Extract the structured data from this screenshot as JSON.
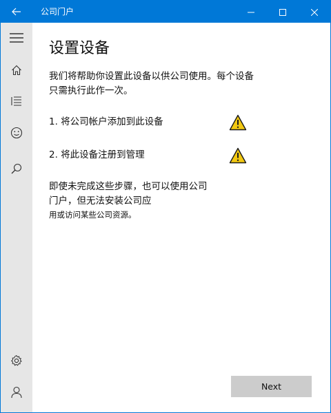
{
  "window": {
    "title": "公司门户",
    "accent_color": "#0078d7",
    "rail_color": "#e6e6e6"
  },
  "titlebar": {
    "back_icon": "back-arrow-icon",
    "minimize_icon": "minimize-icon",
    "maximize_icon": "maximize-icon",
    "close_icon": "close-icon"
  },
  "rail": {
    "items": [
      {
        "icon": "hamburger-menu-icon"
      },
      {
        "icon": "home-icon"
      },
      {
        "icon": "list-icon"
      },
      {
        "icon": "smiley-icon"
      },
      {
        "icon": "search-icon"
      }
    ],
    "bottom_items": [
      {
        "icon": "settings-gear-icon"
      },
      {
        "icon": "account-person-icon"
      }
    ]
  },
  "main": {
    "heading": "设置设备",
    "intro": "我们将帮助你设置此设备以供公司使用。每个设备只需执行此作一次。",
    "steps": [
      {
        "label": "1. 将公司帐户添加到此设备",
        "status_icon": "warning-icon",
        "status_color": "#f2c811"
      },
      {
        "label": "2. 将此设备注册到管理",
        "status_icon": "warning-icon",
        "status_color": "#f2c811"
      }
    ],
    "note_main": "即使未完成这些步骤，也可以使用公司门户，但无法安装公司应",
    "note_tail": "用或访问某些公司资源。",
    "next_label": "Next"
  }
}
